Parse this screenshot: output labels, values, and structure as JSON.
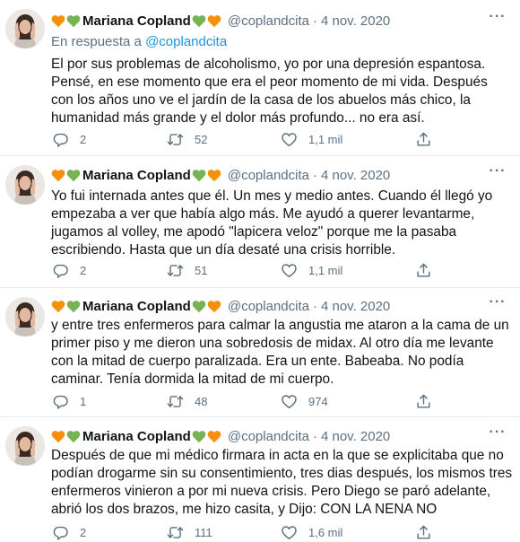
{
  "colors": {
    "text": "#0f1419",
    "secondary": "#5b7083",
    "link": "#1b95e0",
    "heart_orange": "#f4900c",
    "heart_green": "#77b255",
    "divider": "#e6ecf0"
  },
  "icons": [
    "avatar",
    "orange-heart-emoji",
    "green-heart-emoji",
    "more-icon",
    "reply-icon",
    "retweet-icon",
    "like-icon",
    "share-icon"
  ],
  "tweets": [
    {
      "author": "Mariana Copland",
      "handle": "@coplandcita",
      "separator": "·",
      "date": "4 nov. 2020",
      "more": "···",
      "reply_prefix": "En respuesta a",
      "reply_mention": "@coplandcita",
      "text": "El por sus problemas de alcoholismo, yo por una depresión espantosa. Pensé, en ese momento que era el peor momento de mi vida. Después con los años uno ve el jardín de la casa de los abuelos más chico, la humanidad más grande y el dolor más profundo... no era así.",
      "replies": "2",
      "retweets": "52",
      "likes": "1,1 mil"
    },
    {
      "author": "Mariana Copland",
      "handle": "@coplandcita",
      "separator": "·",
      "date": "4 nov. 2020",
      "more": "···",
      "text": "Yo fui internada antes que él. Un mes y medio antes. Cuando él llegó yo empezaba a ver que había algo más. Me ayudó a querer levantarme, jugamos al volley, me apodó \"lapicera veloz\" porque me la pasaba escribiendo. Hasta que un día desaté una crisis horrible.",
      "replies": "2",
      "retweets": "51",
      "likes": "1,1 mil"
    },
    {
      "author": "Mariana Copland",
      "handle": "@coplandcita",
      "separator": "·",
      "date": "4 nov. 2020",
      "more": "···",
      "text": "y entre tres enfermeros para calmar la angustia me ataron a la cama de un primer piso y me dieron una sobredosis de midax. Al otro día me levante con la mitad de cuerpo paralizada. Era un ente. Babeaba. No podía caminar. Tenía dormida la mitad de mi cuerpo.",
      "replies": "1",
      "retweets": "48",
      "likes": "974"
    },
    {
      "author": "Mariana Copland",
      "handle": "@coplandcita",
      "separator": "·",
      "date": "4 nov. 2020",
      "more": "···",
      "text": "Después de que mi médico firmara in acta en la que se explicitaba que no podían drogarme sin su consentimiento, tres dias después, los mismos tres enfermeros vinieron a por mi nueva crisis. Pero Diego se paró adelante, abrió los dos brazos, me hizo casita, y Dijo: CON LA NENA NO",
      "replies": "2",
      "retweets": "111",
      "likes": "1,6 mil"
    }
  ]
}
